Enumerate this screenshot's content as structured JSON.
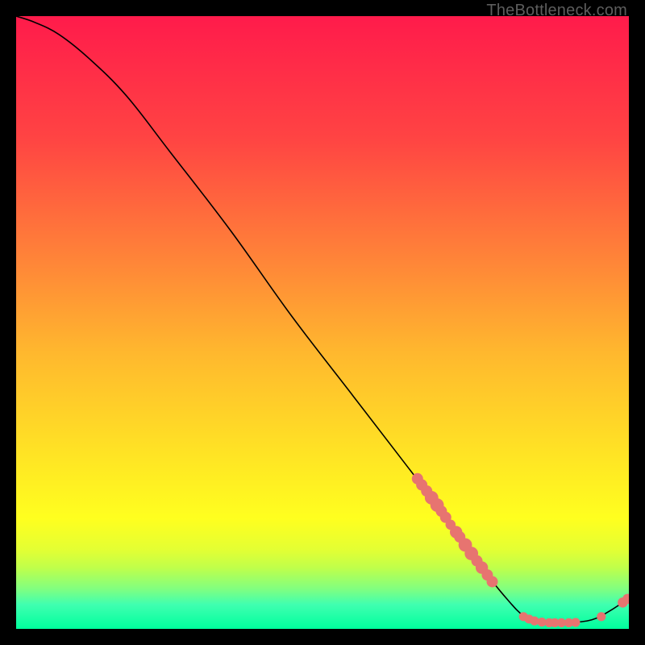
{
  "watermark": "TheBottleneck.com",
  "chart_data": {
    "type": "line",
    "title": "",
    "xlabel": "",
    "ylabel": "",
    "xlim": [
      0,
      100
    ],
    "ylim": [
      0,
      100
    ],
    "gradient_stops": [
      {
        "offset": 0,
        "color": "#ff1b4b"
      },
      {
        "offset": 20,
        "color": "#ff4443"
      },
      {
        "offset": 40,
        "color": "#ff8538"
      },
      {
        "offset": 55,
        "color": "#ffb82e"
      },
      {
        "offset": 72,
        "color": "#ffe524"
      },
      {
        "offset": 82,
        "color": "#ffff1f"
      },
      {
        "offset": 87,
        "color": "#e4ff33"
      },
      {
        "offset": 90,
        "color": "#c0ff4a"
      },
      {
        "offset": 93.5,
        "color": "#80ff80"
      },
      {
        "offset": 96,
        "color": "#40ffb0"
      },
      {
        "offset": 100,
        "color": "#00ff9d"
      }
    ],
    "curve": [
      {
        "x": 0,
        "y": 100
      },
      {
        "x": 3,
        "y": 99
      },
      {
        "x": 7,
        "y": 97
      },
      {
        "x": 12,
        "y": 93
      },
      {
        "x": 18,
        "y": 87
      },
      {
        "x": 25,
        "y": 78
      },
      {
        "x": 35,
        "y": 65
      },
      {
        "x": 45,
        "y": 51
      },
      {
        "x": 55,
        "y": 38
      },
      {
        "x": 65,
        "y": 25
      },
      {
        "x": 71,
        "y": 17
      },
      {
        "x": 76,
        "y": 10
      },
      {
        "x": 80,
        "y": 5
      },
      {
        "x": 83,
        "y": 2
      },
      {
        "x": 86,
        "y": 1
      },
      {
        "x": 90,
        "y": 1
      },
      {
        "x": 94,
        "y": 1.5
      },
      {
        "x": 97,
        "y": 3
      },
      {
        "x": 100,
        "y": 5
      }
    ],
    "markers": [
      {
        "x": 65.5,
        "y": 24.5,
        "r": 1.0
      },
      {
        "x": 66.2,
        "y": 23.5,
        "r": 1.0
      },
      {
        "x": 67.0,
        "y": 22.5,
        "r": 1.0
      },
      {
        "x": 67.8,
        "y": 21.4,
        "r": 1.2
      },
      {
        "x": 68.7,
        "y": 20.2,
        "r": 1.2
      },
      {
        "x": 69.4,
        "y": 19.2,
        "r": 1.0
      },
      {
        "x": 70.1,
        "y": 18.2,
        "r": 1.0
      },
      {
        "x": 70.9,
        "y": 17.0,
        "r": 0.9
      },
      {
        "x": 71.8,
        "y": 15.8,
        "r": 1.1
      },
      {
        "x": 72.4,
        "y": 15.0,
        "r": 1.0
      },
      {
        "x": 73.3,
        "y": 13.7,
        "r": 1.2
      },
      {
        "x": 74.3,
        "y": 12.3,
        "r": 1.2
      },
      {
        "x": 75.2,
        "y": 11.1,
        "r": 1.0
      },
      {
        "x": 76.0,
        "y": 10.0,
        "r": 1.1
      },
      {
        "x": 76.9,
        "y": 8.8,
        "r": 1.0
      },
      {
        "x": 77.7,
        "y": 7.7,
        "r": 1.0
      },
      {
        "x": 82.8,
        "y": 2.0,
        "r": 0.8
      },
      {
        "x": 83.7,
        "y": 1.6,
        "r": 0.8
      },
      {
        "x": 84.6,
        "y": 1.3,
        "r": 0.8
      },
      {
        "x": 85.8,
        "y": 1.1,
        "r": 0.8
      },
      {
        "x": 87.0,
        "y": 1.0,
        "r": 0.8
      },
      {
        "x": 87.9,
        "y": 1.0,
        "r": 0.8
      },
      {
        "x": 89.0,
        "y": 1.0,
        "r": 0.8
      },
      {
        "x": 90.2,
        "y": 1.0,
        "r": 0.8
      },
      {
        "x": 91.3,
        "y": 1.05,
        "r": 0.8
      },
      {
        "x": 95.5,
        "y": 2.0,
        "r": 0.8
      },
      {
        "x": 99.0,
        "y": 4.3,
        "r": 0.9
      },
      {
        "x": 99.8,
        "y": 4.9,
        "r": 0.9
      }
    ],
    "marker_color": "#e77470",
    "curve_color": "#000000"
  }
}
